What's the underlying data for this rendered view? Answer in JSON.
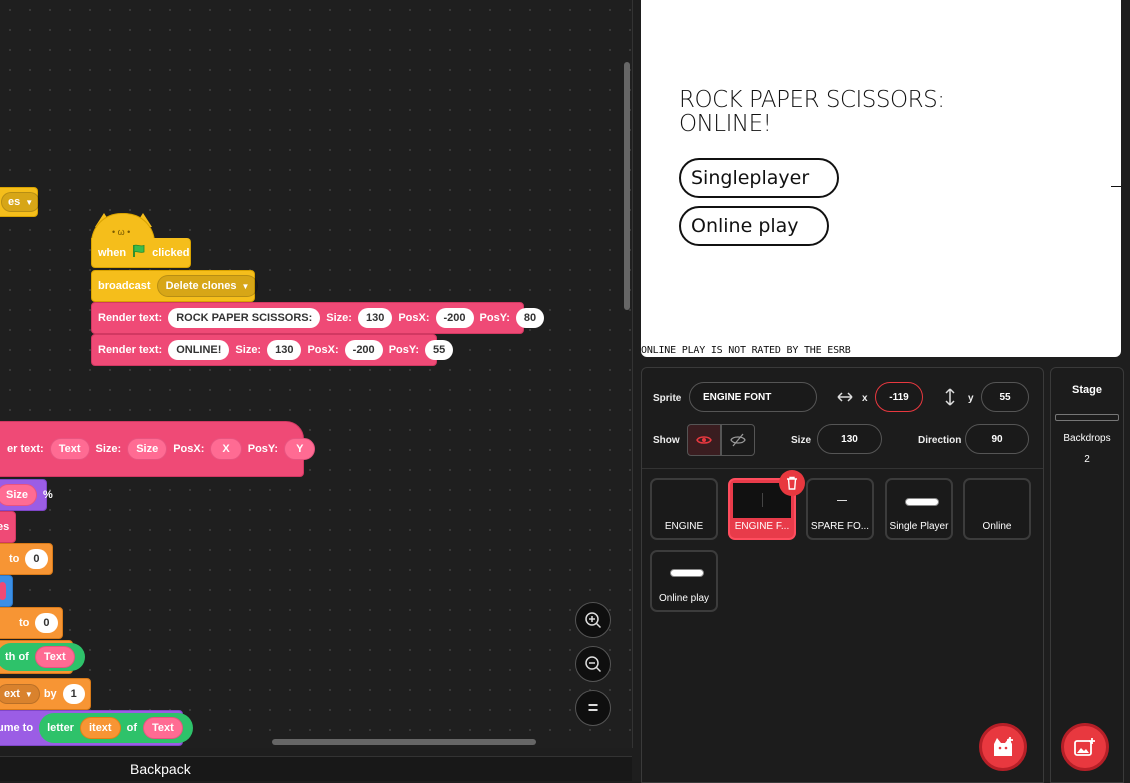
{
  "code": {
    "stack": {
      "when_label": "when",
      "clicked_label": "clicked",
      "broadcast_label": "broadcast",
      "broadcast_value": "Delete clones",
      "render1": {
        "label": "Render text:",
        "text": "ROCK PAPER SCISSORS:",
        "size_label": "Size:",
        "size": "130",
        "posx_label": "PosX:",
        "posx": "-200",
        "posy_label": "PosY:",
        "posy": "80"
      },
      "render2": {
        "label": "Render text:",
        "text": "ONLINE!",
        "size_label": "Size:",
        "size": "130",
        "posx_label": "PosX:",
        "posx": "-200",
        "posy_label": "PosY:",
        "posy": "55"
      }
    },
    "partial_dropdown": "es",
    "define": {
      "label": "er text:",
      "text": "Text",
      "size_label": "Size:",
      "size": "Size",
      "posx_label": "PosX:",
      "posx": "X",
      "posy_label": "PosY:",
      "posy": "Y"
    },
    "size_pct": {
      "arg": "Size",
      "pct": "%"
    },
    "es_block": "es",
    "to_zero_1": {
      "to": "to",
      "val": "0"
    },
    "to_zero_2": {
      "to": "to",
      "val": "0"
    },
    "length_of": {
      "label": "th of",
      "arg": "Text"
    },
    "change_by": {
      "var": "ext",
      "by": "by",
      "val": "1"
    },
    "set_to_letter": {
      "label": "ume to",
      "letter": "letter",
      "idx": "itext",
      "of": "of",
      "arg": "Text"
    },
    "zoom_in": "+",
    "zoom_out": "−",
    "zoom_reset": "="
  },
  "backpack": {
    "label": "Backpack"
  },
  "stage": {
    "title_line1": "ROCK PAPER SCISSORS:",
    "title_line2": "ONLINE!",
    "btn_single": "Singleplayer",
    "btn_online": "Online play",
    "footer": "ONLINE PLAY IS NOT RATED BY THE ESRB"
  },
  "sprite_info": {
    "sprite_label": "Sprite",
    "sprite_name": "ENGINE FONT",
    "x_label": "x",
    "x_value": "-119",
    "y_label": "y",
    "y_value": "55",
    "show_label": "Show",
    "size_label": "Size",
    "size_value": "130",
    "direction_label": "Direction",
    "direction_value": "90"
  },
  "sprites": [
    {
      "name": "ENGINE"
    },
    {
      "name": "ENGINE F..."
    },
    {
      "name": "SPARE FO..."
    },
    {
      "name": "Single Player"
    },
    {
      "name": "Online"
    },
    {
      "name": "Online play"
    }
  ],
  "stage_panel": {
    "title": "Stage",
    "backdrops_label": "Backdrops",
    "backdrops_count": "2"
  },
  "colors": {
    "accent": "#e8383f",
    "looks": "#ef4a76",
    "events": "#f5be1b"
  }
}
